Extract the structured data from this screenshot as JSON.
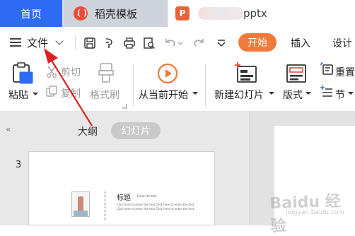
{
  "tabs": {
    "home": "首页",
    "template": "稻壳模板",
    "doc_suffix": "pptx",
    "doc_logo": "P"
  },
  "menu": {
    "file": "文件",
    "start": "开始",
    "insert": "插入",
    "design": "设计"
  },
  "ribbon": {
    "paste": "粘贴",
    "cut": "剪切",
    "copy": "复制",
    "format_painter": "格式刷",
    "from_current": "从当前开始",
    "new_slide": "新建幻灯片",
    "layout": "版式",
    "section": "节",
    "reset": "重置"
  },
  "panel": {
    "collapse": "«",
    "outline": "大纲",
    "slides": "幻灯片",
    "slide_number": "3"
  },
  "thumbnail": {
    "title": "标题",
    "subtitle": "Enter the title",
    "body": "Click here to enter the text Click here to enter the text Click here to enter the text Click here to enter the text"
  },
  "watermark": {
    "text": "Baidu 经验",
    "url": "jingyan.baidu.com"
  },
  "colors": {
    "accent_blue": "#2d6bf2",
    "start_orange": "#f07a3a",
    "arrow_red": "#e02020"
  }
}
